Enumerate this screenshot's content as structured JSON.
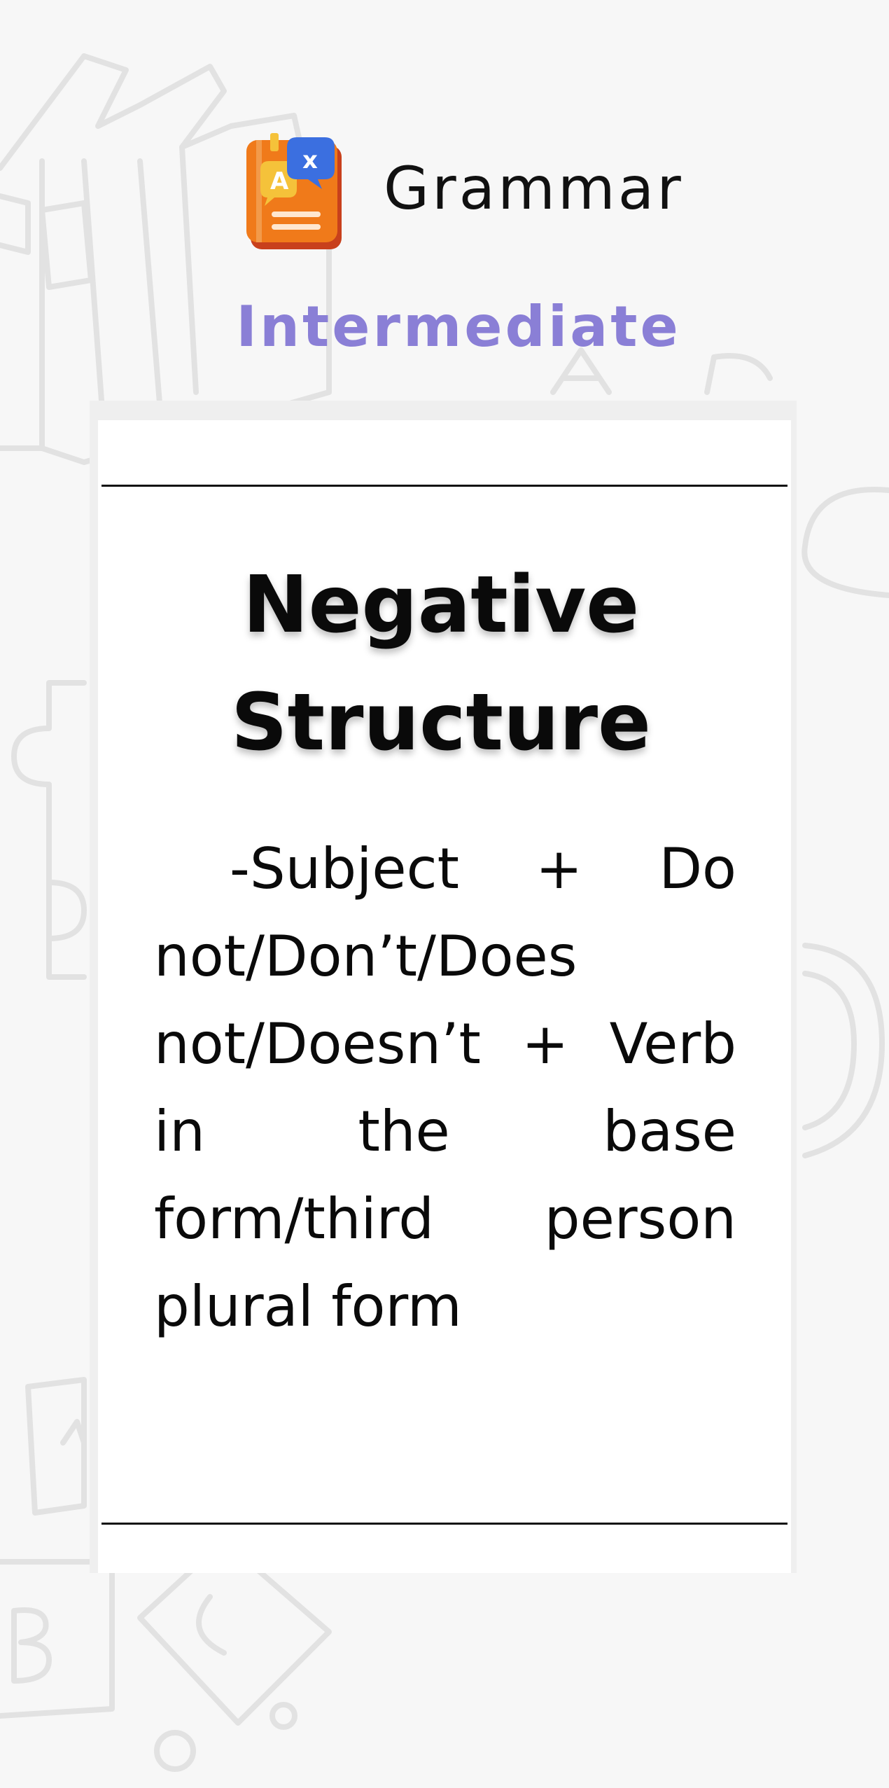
{
  "header": {
    "app_title": "Grammar",
    "level": "Intermediate",
    "icon": "grammar-book-icon"
  },
  "card": {
    "title": "Negative Structure",
    "body": "-Subject + Do not/Don’t/Does not/Doesn’t + Verb in the base form/third person plural form"
  },
  "colors": {
    "level_accent": "#8a7fd6",
    "background": "#f7f7f7",
    "card": "#ffffff",
    "book_orange": "#f07a1a",
    "bubble_blue": "#3b6fe0",
    "bubble_yellow": "#f5c23a"
  }
}
